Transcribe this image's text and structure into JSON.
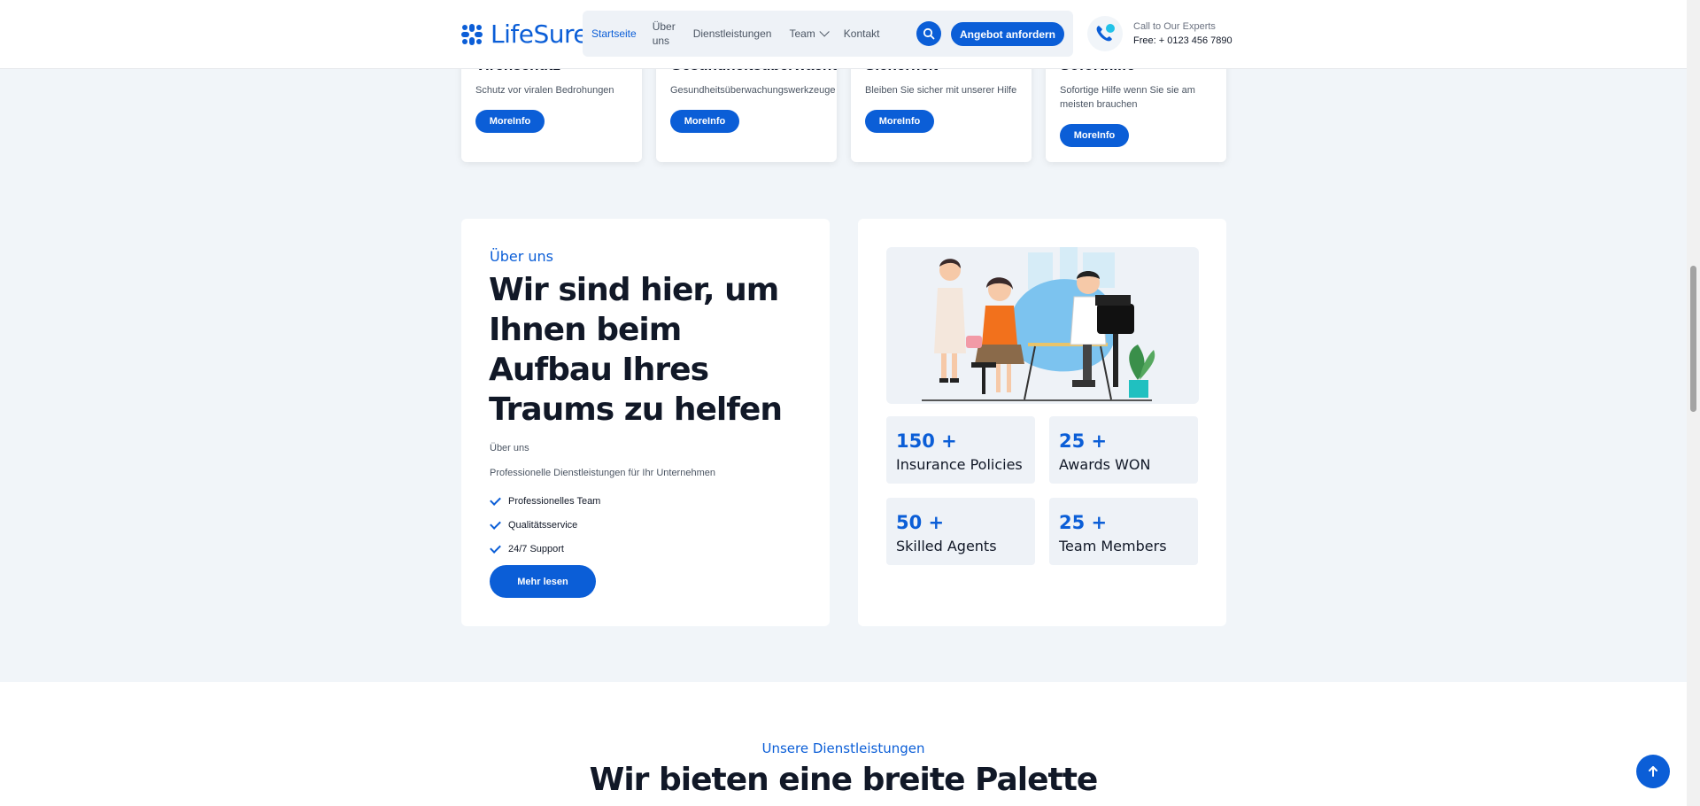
{
  "header": {
    "logo_text": "LifeSure",
    "nav": {
      "home": "Startseite",
      "about_line1": "Über",
      "about_line2": "uns",
      "services": "Dienstleistungen",
      "team": "Team",
      "contact": "Kontakt"
    },
    "quote_button": "Angebot anfordern",
    "contact_line1": "Call to Our Experts",
    "contact_line2": "Free: + 0123 456 7890"
  },
  "feature_cards": [
    {
      "title": "Virenschutz",
      "desc": "Schutz vor viralen Bedrohungen",
      "button": "MoreInfo"
    },
    {
      "title": "Gesundheitsüberwachung",
      "desc": "Gesundheitsüberwachungswerkzeuge",
      "button": "MoreInfo"
    },
    {
      "title": "Sicherheit",
      "desc": "Bleiben Sie sicher mit unserer Hilfe",
      "button": "MoreInfo"
    },
    {
      "title": "Soforthilfe",
      "desc": "Sofortige Hilfe wenn Sie sie am meisten brauchen",
      "button": "MoreInfo"
    }
  ],
  "about": {
    "eyebrow": "Über uns",
    "heading": "Wir sind hier, um Ihnen beim Aufbau Ihres Traums zu helfen",
    "sub1": "Über uns",
    "sub2": "Professionelle Dienstleistungen für Ihr Unternehmen",
    "checks": [
      "Professionelles Team",
      "Qualitätsservice",
      "24/7 Support"
    ],
    "button": "Mehr lesen"
  },
  "stats": [
    {
      "number": "150 +",
      "label": "Insurance Policies"
    },
    {
      "number": "25 +",
      "label": "Awards WON"
    },
    {
      "number": "50 +",
      "label": "Skilled Agents"
    },
    {
      "number": "25 +",
      "label": "Team Members"
    }
  ],
  "services": {
    "eyebrow": "Unsere Dienstleistungen",
    "heading": "Wir bieten eine breite Palette"
  },
  "colors": {
    "primary": "#0b5ed7",
    "page_bg": "#f1f5f9",
    "card_bg": "#ffffff"
  }
}
